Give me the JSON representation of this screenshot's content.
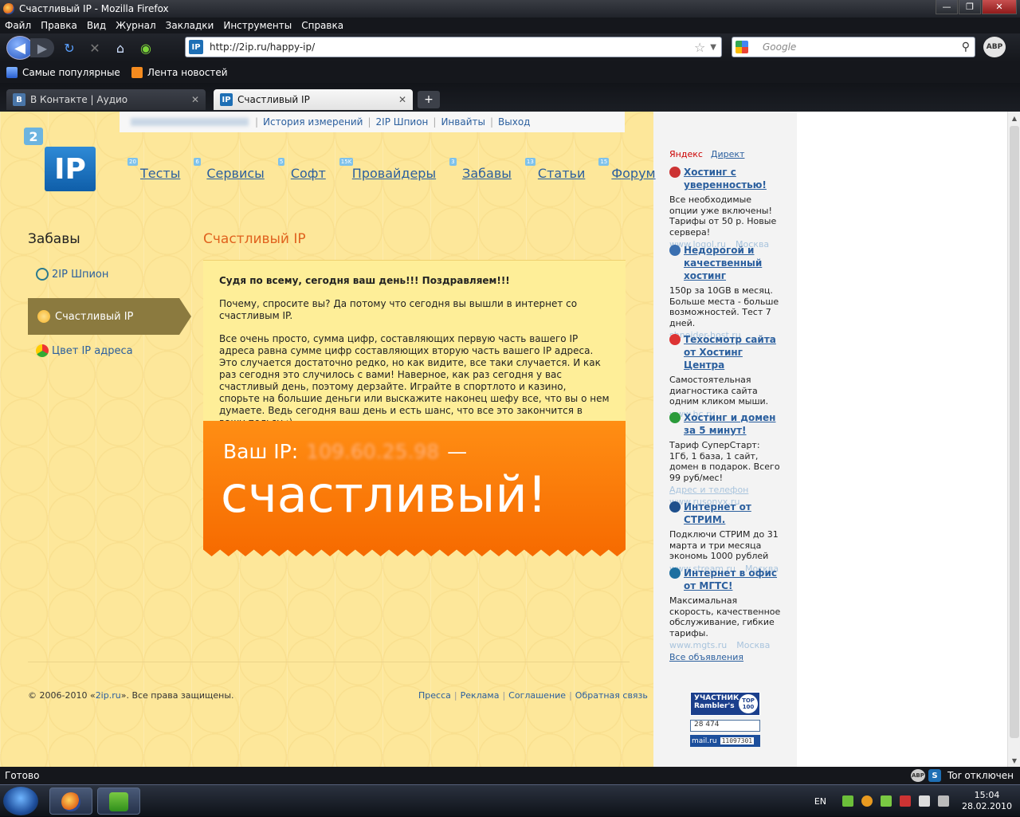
{
  "window": {
    "title": "Счастливый IP - Mozilla Firefox",
    "controls": [
      "—",
      "❐",
      "✕"
    ]
  },
  "menu": [
    "Файл",
    "Правка",
    "Вид",
    "Журнал",
    "Закладки",
    "Инструменты",
    "Справка"
  ],
  "toolbar": {
    "url": "http://2ip.ru/happy-ip/",
    "url_icon": "IP",
    "search_placeholder": "Google",
    "abp": "ABP"
  },
  "bookmarks": [
    "Самые популярные",
    "Лента новостей"
  ],
  "tabs": [
    {
      "icon": "B",
      "label": "В Контакте | Аудио",
      "active": false
    },
    {
      "icon": "IP",
      "label": "Счастливый IP",
      "active": true
    }
  ],
  "newtab_label": "+",
  "site": {
    "topbar_links": [
      "История измерений",
      "2IP Шпион",
      "Инвайты",
      "Выход"
    ],
    "logo_badge": "2",
    "logo_text": "IP",
    "nav": [
      {
        "label": "Тесты",
        "count": "20"
      },
      {
        "label": "Сервисы",
        "count": "6"
      },
      {
        "label": "Софт",
        "count": "5"
      },
      {
        "label": "Провайдеры",
        "count": "15K"
      },
      {
        "label": "Забавы",
        "count": "3"
      },
      {
        "label": "Статьи",
        "count": "13"
      },
      {
        "label": "Форум",
        "count": "15"
      }
    ],
    "left_title": "Забавы",
    "left_items": [
      "2IP Шпион",
      "Счастливый IP",
      "Цвет IP адреса"
    ],
    "content_title": "Счастливый IP",
    "message": {
      "lead": "Судя по всему, сегодня ваш день!!! Поздравляем!!!",
      "p1": "Почему, спросите вы? Да потому что сегодня вы вышли в интернет со счастливым IP.",
      "p2": "Все очень просто, сумма цифр, составляющих первую часть вашего IP адреса равна сумме цифр составляющих вторую часть вашего IP адреса.  Это случается достаточно редко, но как видите, все таки случается. И как раз сегодня это случилось с вами! Наверное, как раз сегодня у вас счастливый день, поэтому дерзайте. Играйте в спортлото и казино, спорьте на большие деньги или выскажите наконец  шефу все, что вы о нем думаете. Ведь сегодня ваш день и есть шанс, что все это закончится в вашу пользу :)"
    },
    "banner": {
      "prefix": "Ваш IP:",
      "ip": "109.60.25.98",
      "dash": "—",
      "word": "счастливый!"
    },
    "copyright_prefix": "© 2006-2010 «",
    "copyright_link": "2ip.ru",
    "copyright_suffix": "». Все права защищены.",
    "footer_links": [
      "Пресса",
      "Реклама",
      "Соглашение",
      "Обратная связь"
    ]
  },
  "ads": {
    "yandex": "Яндекс",
    "direct": "Директ",
    "items": [
      {
        "title": "Хостинг с уверенностью!",
        "text": "Все необходимые опции уже включены! Тарифы от 50 р. Новые сервера!",
        "url": "www.logol.ru",
        "city": "Москва",
        "extra": "",
        "icon_color": "#c33"
      },
      {
        "title": "Недорогой и качественный хостинг",
        "text": "150р за 10GB в месяц. Больше места - больше возможностей. Тест 7 дней.",
        "url": "shneider-host.ru",
        "city": "",
        "extra": "",
        "icon_color": "#3a6fb0"
      },
      {
        "title": "Техосмотр сайта от Хостинг Центра",
        "text": "Самостоятельная диагностика сайта одним кликом мыши.",
        "url": "www.hc.ru",
        "city": "",
        "extra": "",
        "icon_color": "#d33"
      },
      {
        "title": "Хостинг и домен за 5 минут!",
        "text": "Тариф СуперСтарт: 1Гб, 1 база, 1 сайт, домен в подарок. Всего 99 руб/мес!",
        "url": "www.rusonyx.ru",
        "city": "",
        "extra": "Адрес и телефон",
        "icon_color": "#2a9a3a"
      },
      {
        "title": "Интернет от СТРИМ.",
        "text": "Подключи СТРИМ до 31 марта и три месяца экономь 1000 рублей",
        "url": "www.stream.ru",
        "city": "Москва",
        "extra": "",
        "icon_color": "#1d4f8c"
      },
      {
        "title": "Интернет в офис от МГТС!",
        "text": "Максимальная скорость, качественное обслуживание, гибкие тарифы.",
        "url": "www.mgts.ru",
        "city": "Москва",
        "extra": "",
        "icon_color": "#1d6fa0"
      }
    ],
    "all_ads": "Все объявления"
  },
  "counters": {
    "rambler_line1": "УЧАСТНИК",
    "rambler_line2": "Rambler's",
    "rambler_top": "TOP 100",
    "li": "28 474",
    "mail_brand": "mail.ru",
    "mail_num": "11097301"
  },
  "status": {
    "text": "Готово",
    "abp": "ABP",
    "s": "S",
    "tor": "Tor отключен"
  },
  "taskbar": {
    "lang": "EN",
    "time": "15:04",
    "date": "28.02.2010"
  }
}
